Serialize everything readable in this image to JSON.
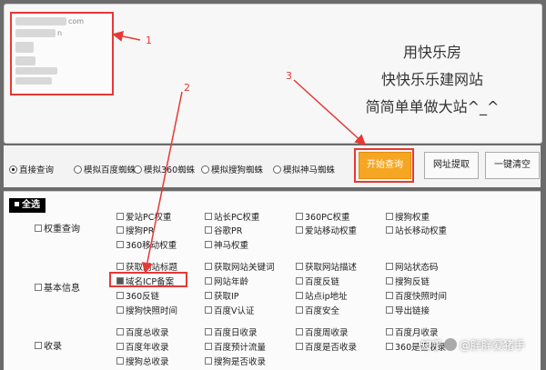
{
  "domains": [
    "com",
    "n"
  ],
  "slogan": {
    "line1": "用快乐房",
    "line2": "快快乐乐建网站",
    "line3": "简简单单做大站^_^"
  },
  "modes": [
    {
      "label": "直接查询",
      "selected": true
    },
    {
      "label": "模拟百度蜘蛛",
      "selected": false
    },
    {
      "label": "模拟360蜘蛛",
      "selected": false
    },
    {
      "label": "模拟搜狗蜘蛛",
      "selected": false
    },
    {
      "label": "模拟神马蜘蛛",
      "selected": false
    }
  ],
  "buttons": {
    "start": "开始查询",
    "extract": "网址提取",
    "clear": "一键清空"
  },
  "select_all": "全选",
  "categories": {
    "weight": "权重查询",
    "basic": "基本信息",
    "index": "收录"
  },
  "options": {
    "weight": [
      "爱站PC权重",
      "站长PC权重",
      "360PC权重",
      "搜狗权重",
      "搜狗PR",
      "谷歌PR",
      "爱站移动权重",
      "站长移动权重",
      "360移动权重",
      "神马权重"
    ],
    "basic": [
      "获取网站标题",
      "获取网站关键词",
      "获取网站描述",
      "网站状态码",
      "域名ICP备案",
      "网站年龄",
      "百度反链",
      "搜狗反链",
      "360反链",
      "获取IP",
      "站点ip地址",
      "百度快照时间",
      "搜狗快照时间",
      "百度V认证",
      "百度安全",
      "导出链接"
    ],
    "index": [
      "百度总收录",
      "百度日收录",
      "百度周收录",
      "百度月收录",
      "百度年收录",
      "百度预计流量",
      "百度是否收录",
      "360是否收录",
      "搜狗总收录",
      "搜狗是否收录"
    ]
  },
  "annotations": {
    "n1": "1",
    "n2": "2",
    "n3": "3"
  },
  "watermark": {
    "prefix": "知乎",
    "author": "@胖胖爱猪手"
  },
  "colors": {
    "annotation": "#e53935",
    "start_button": "#f5a623"
  }
}
